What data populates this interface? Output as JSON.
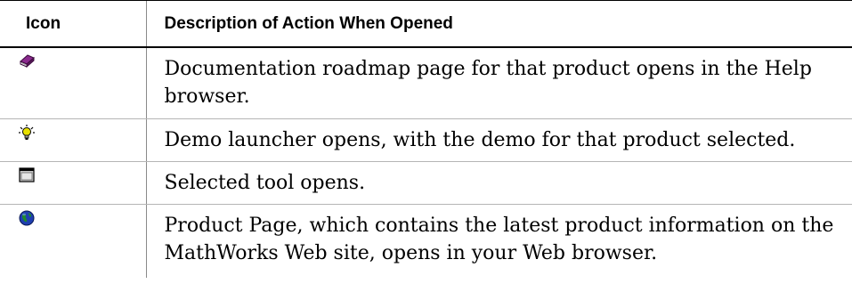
{
  "table": {
    "headers": {
      "icon": "Icon",
      "description": "Description of Action When Opened"
    },
    "rows": [
      {
        "icon": "book-icon",
        "description": "Documentation roadmap page for that product opens in the Help browser."
      },
      {
        "icon": "lightbulb-icon",
        "description": "Demo launcher opens, with the demo for that product selected."
      },
      {
        "icon": "tool-window-icon",
        "description": "Selected tool opens."
      },
      {
        "icon": "globe-icon",
        "description": "Product Page, which contains the latest product information on the MathWorks Web site, opens in your Web browser."
      }
    ]
  },
  "colors": {
    "book": "#8b2a8e",
    "lightbulb": "#e8e000",
    "globe_water": "#1f3fb0",
    "globe_land": "#1e8a2a"
  }
}
